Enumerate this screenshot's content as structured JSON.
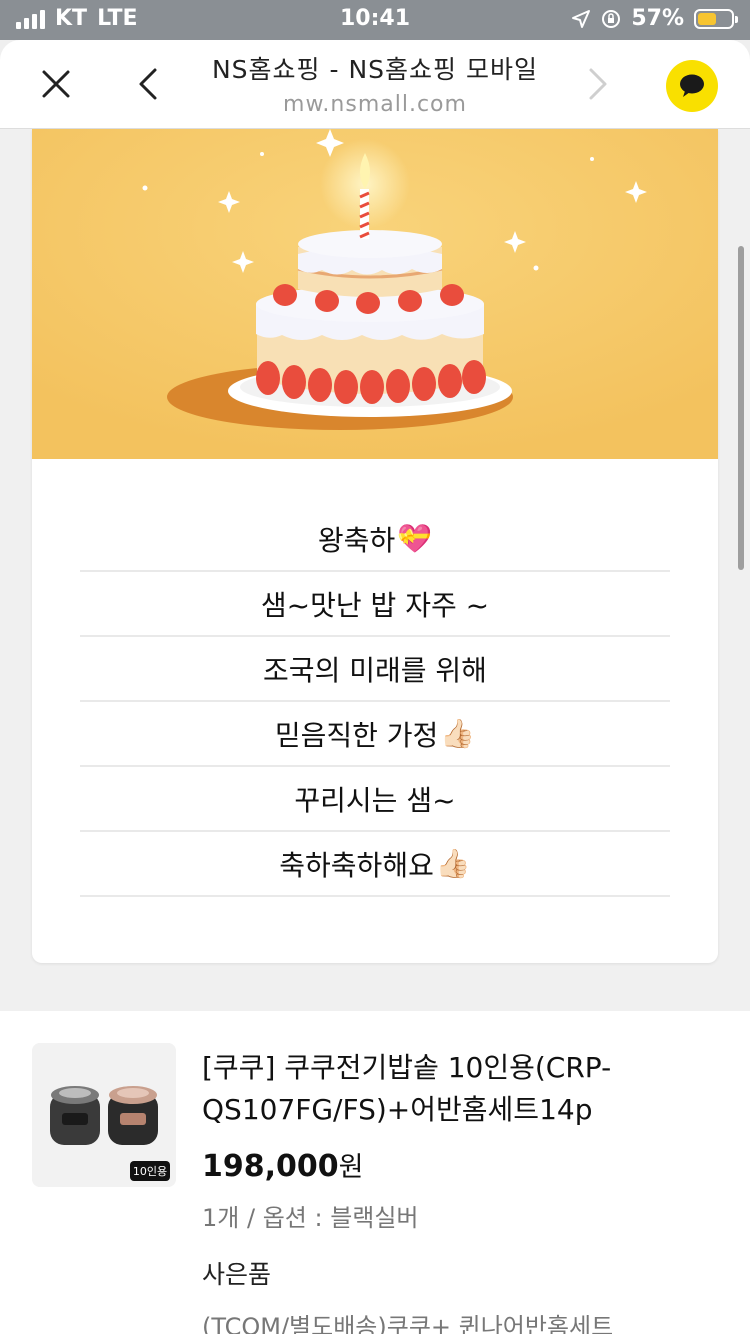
{
  "status": {
    "carrier": "KT",
    "network": "LTE",
    "time": "10:41",
    "battery": "57%",
    "battery_level": 0.57
  },
  "nav": {
    "title": "NS홈쇼핑 - NS홈쇼핑 모바일",
    "url": "mw.nsmall.com",
    "icons": [
      "close-icon",
      "back-icon",
      "forward-icon",
      "kakao-chat-icon"
    ]
  },
  "message_lines": [
    {
      "text": "왕축하",
      "emoji": "💝"
    },
    {
      "text": "샘~맛난 밥 자주 ~",
      "emoji": ""
    },
    {
      "text": "조국의 미래를 위해",
      "emoji": ""
    },
    {
      "text": "믿음직한 가정",
      "emoji": "👍🏻"
    },
    {
      "text": "꾸리시는 샘~",
      "emoji": ""
    },
    {
      "text": "축하축하해요",
      "emoji": "👍🏻"
    }
  ],
  "product": {
    "name": "[쿠쿠] 쿠쿠전기밥솥 10인용(CRP-QS107FG/FS)+어반홈세트14p",
    "price": "198,000",
    "currency": "원",
    "option": "1개 / 옵션 : 블랙실버",
    "gift_label": "사은품",
    "gift": "(TCOM/별도배송)쿠쿠+ 퀸나어반홈세트",
    "thumb_badge": "10인용"
  },
  "colors": {
    "banner_bg": "#f5c766",
    "kakao_yellow": "#f9e000",
    "status_bg": "#8a8f94"
  }
}
